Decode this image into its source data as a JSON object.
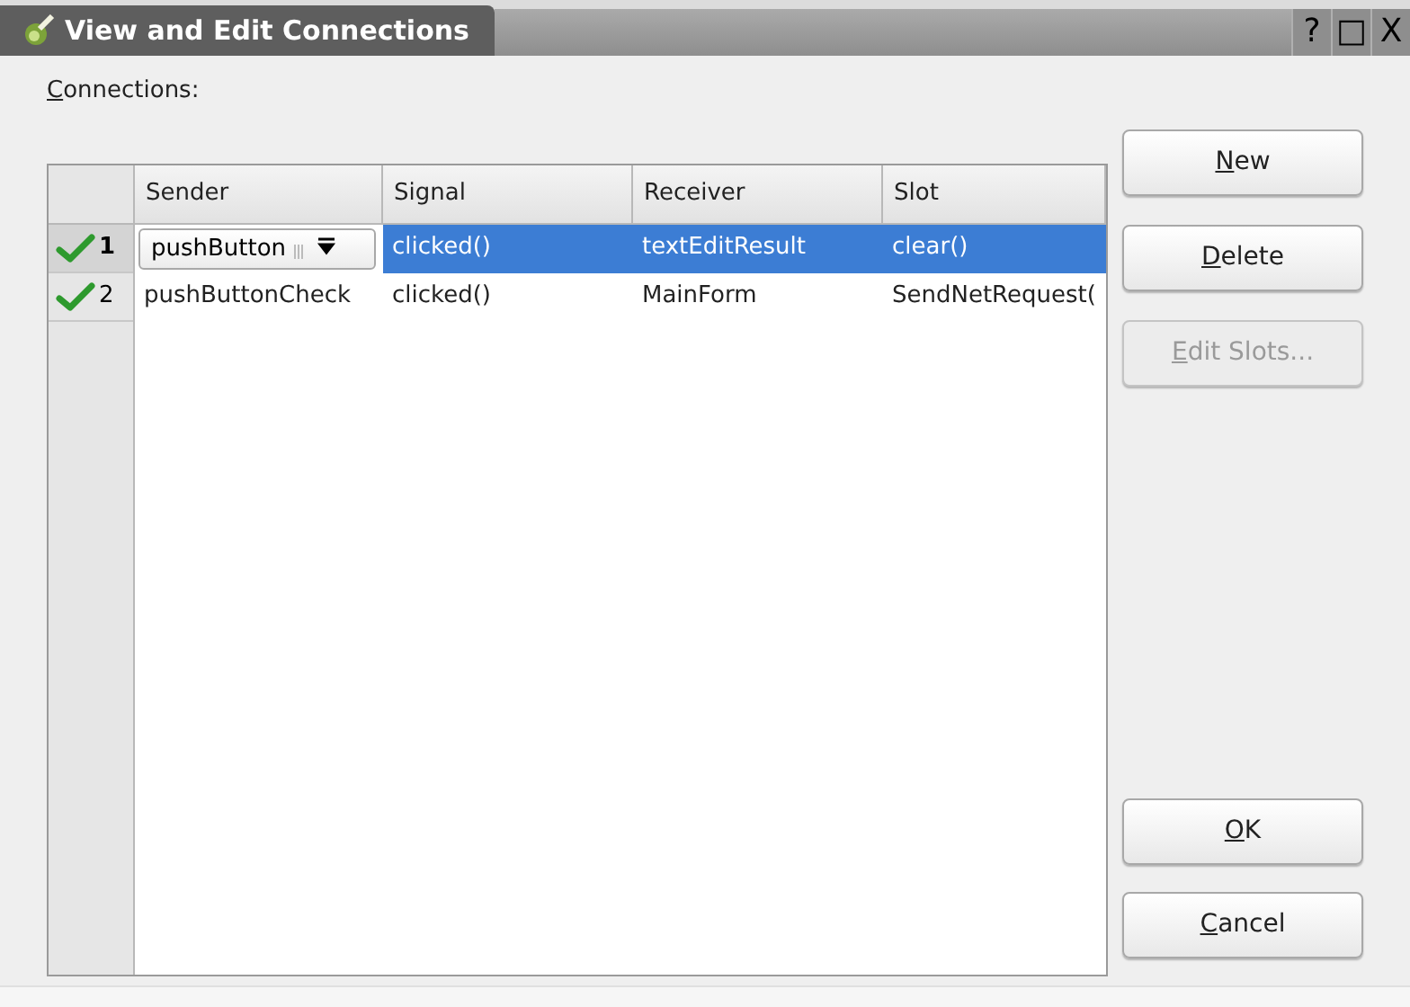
{
  "window": {
    "title": "View and Edit Connections",
    "controls": [
      "?",
      "□",
      "X"
    ]
  },
  "label": "Connections:",
  "table": {
    "columns": [
      "Sender",
      "Signal",
      "Receiver",
      "Slot"
    ],
    "rows": [
      {
        "number": "1",
        "selected": true,
        "editing": true,
        "cells": [
          "pushButton",
          "clicked()",
          "textEditResult",
          "clear()"
        ]
      },
      {
        "number": "2",
        "selected": false,
        "editing": false,
        "cells": [
          "pushButtonCheck",
          "clicked()",
          "MainForm",
          "SendNetRequest("
        ]
      }
    ]
  },
  "buttons": [
    {
      "label": "New",
      "disabled": false
    },
    {
      "label": "Delete",
      "disabled": false
    },
    {
      "label": "Edit Slots...",
      "disabled": true
    }
  ],
  "dialog_buttons": [
    {
      "label": "OK",
      "disabled": false
    },
    {
      "label": "Cancel",
      "disabled": false
    }
  ]
}
